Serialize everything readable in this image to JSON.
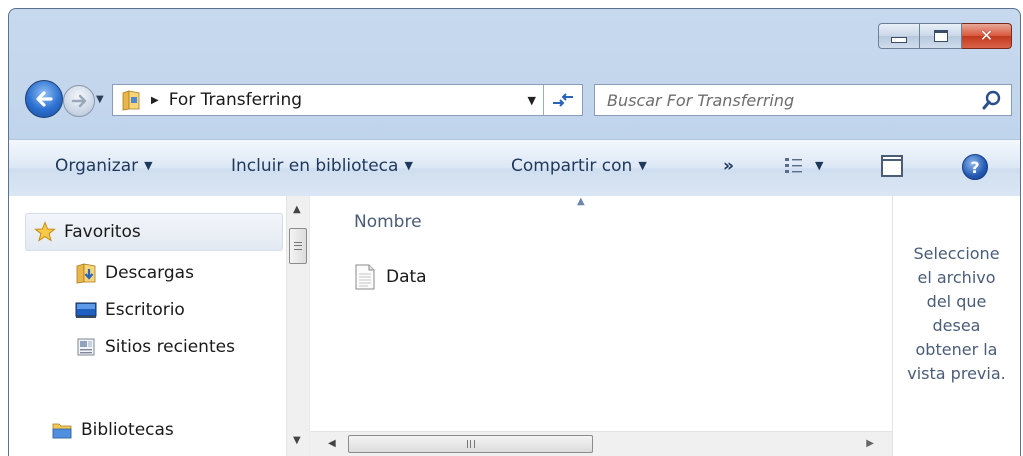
{
  "window": {
    "caption": {
      "minimize": "—",
      "maximize": "□",
      "close": "✕"
    }
  },
  "address": {
    "crumb": "For Transferring",
    "search_placeholder": "Buscar For Transferring"
  },
  "toolbar": {
    "organize": "Organizar",
    "include_library": "Incluir en biblioteca",
    "share_with": "Compartir con",
    "more": "»",
    "help": "?"
  },
  "nav": {
    "favorites": "Favoritos",
    "downloads": "Descargas",
    "desktop": "Escritorio",
    "recent": "Sitios recientes",
    "libraries": "Bibliotecas"
  },
  "files": {
    "column_name": "Nombre",
    "items": [
      {
        "name": "Data"
      }
    ]
  },
  "preview": {
    "lines": [
      "Seleccione",
      "el archivo",
      "del que",
      "desea",
      "obtener la",
      "vista previa."
    ]
  },
  "icons": {
    "back": "back-arrow-icon",
    "forward": "forward-arrow-icon",
    "folder": "folder-icon",
    "refresh": "refresh-icon",
    "search": "search-icon",
    "views": "views-icon",
    "preview_pane": "preview-pane-icon",
    "help": "help-icon",
    "star": "star-icon",
    "document": "document-icon"
  },
  "colors": {
    "chrome": "#b9cfe8",
    "close_button": "#d9573c",
    "toolbar_text": "#1e395b",
    "header_text": "#4a5d78"
  }
}
